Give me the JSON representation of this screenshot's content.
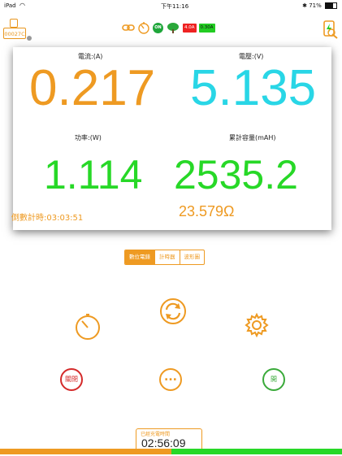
{
  "status_bar": {
    "device": "iPad",
    "time": "下午11:16",
    "battery": "71%"
  },
  "header": {
    "device_code": "00027C",
    "current_chip": "4.0A",
    "voltage_chip": "0.30A",
    "on_label": "ON"
  },
  "panel": {
    "current": {
      "label": "電流:(A)",
      "value": "0.217"
    },
    "voltage": {
      "label": "電壓:(V)",
      "value": "5.135"
    },
    "power": {
      "label": "功率:(W)",
      "value": "1.114"
    },
    "capacity": {
      "label": "累計容量(mAH)",
      "value": "2535.2"
    },
    "countdown": "倒數計時:03:03:51",
    "resistance": "23.579Ω"
  },
  "tabs": [
    {
      "label": "數位電錶",
      "active": true
    },
    {
      "label": "計時器",
      "active": false
    },
    {
      "label": "波形圖",
      "active": false
    }
  ],
  "controls": {
    "close_label": "關閉",
    "open_label": "開",
    "more_label": "..."
  },
  "timer": {
    "label": "已經充電時間",
    "value": "02:56:09"
  },
  "progress": {
    "fraction": 0.5
  },
  "colors": {
    "orange": "#ee9a22",
    "cyan": "#29d6e6",
    "green": "#27d827",
    "red": "#d42a2a"
  }
}
